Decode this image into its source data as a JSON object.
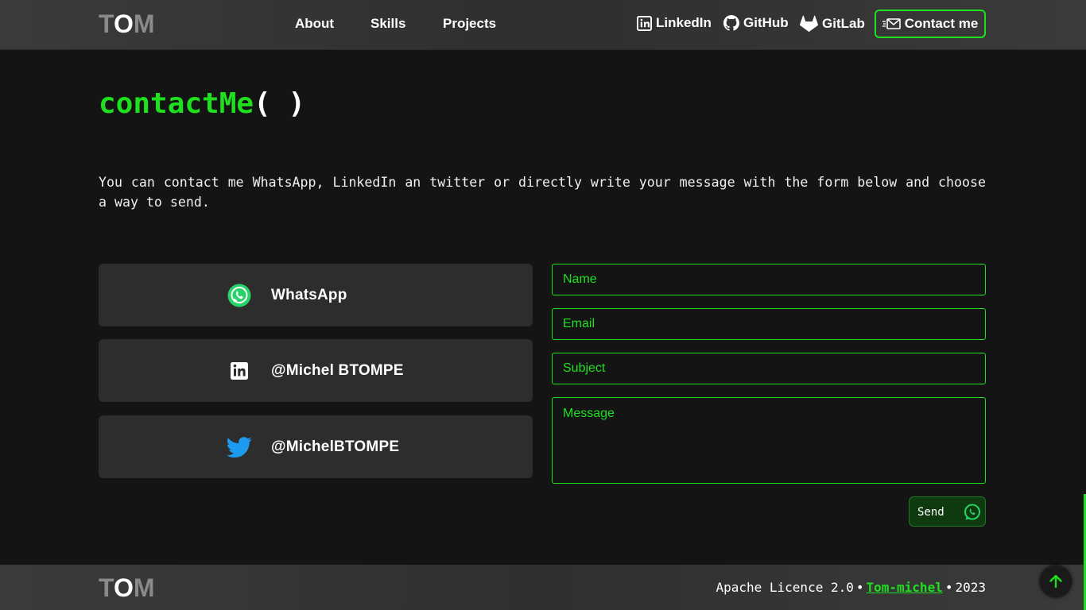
{
  "header": {
    "logo": {
      "t": "T",
      "o": "O",
      "m": "M"
    },
    "nav": [
      {
        "label": "About"
      },
      {
        "label": "Skills"
      },
      {
        "label": "Projects"
      }
    ],
    "social": [
      {
        "label": "LinkedIn",
        "icon": "linkedin-icon"
      },
      {
        "label": "GitHub",
        "icon": "github-icon"
      },
      {
        "label": "GitLab",
        "icon": "gitlab-icon"
      }
    ],
    "contact_button": {
      "label": "Contact me",
      "icon": "mail-icon"
    }
  },
  "main": {
    "title": {
      "fn": "contactMe",
      "parens": "( )"
    },
    "intro": "You can contact me WhatsApp, LinkedIn an twitter or directly write your message with the form below and choose a way to send.",
    "cards": [
      {
        "label": "WhatsApp",
        "icon": "whatsapp-icon"
      },
      {
        "label": "@Michel BTOMPE",
        "icon": "linkedin-icon"
      },
      {
        "label": "@MichelBTOMPE",
        "icon": "twitter-icon"
      }
    ],
    "form": {
      "name_placeholder": "Name",
      "email_placeholder": "Email",
      "subject_placeholder": "Subject",
      "message_placeholder": "Message",
      "send_label": "Send"
    }
  },
  "footer": {
    "logo": {
      "t": "T",
      "o": "O",
      "m": "M"
    },
    "licence": "Apache Licence 2.0",
    "sep": "•",
    "link": "Tom-michel",
    "year": "2023"
  },
  "colors": {
    "accent": "#1fe01f",
    "background": "#141414",
    "card": "#2d2d2d",
    "whatsapp": "#25d366",
    "twitter": "#1d9bf0"
  }
}
